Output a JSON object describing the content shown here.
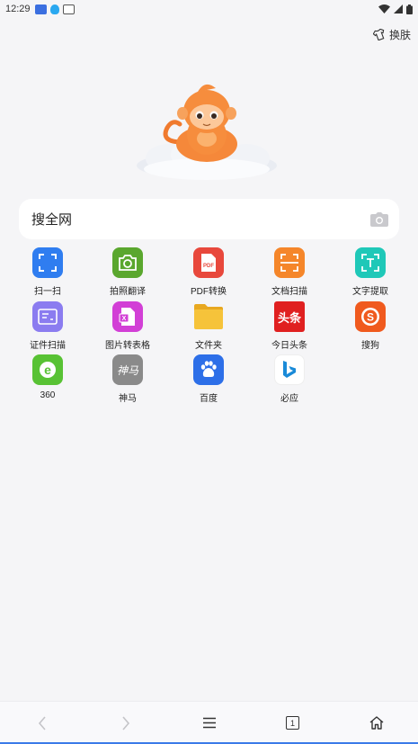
{
  "status_bar": {
    "time": "12:29",
    "notification_icons": [
      "app-badge-icon",
      "qq-penguin-icon",
      "sd-card-icon"
    ]
  },
  "header": {
    "skin_label": "换肤"
  },
  "search": {
    "placeholder": "搜全网",
    "camera_icon": "camera-icon"
  },
  "grid": {
    "items": [
      {
        "label": "扫一扫",
        "icon": "scan-icon",
        "color": "#2f7df0"
      },
      {
        "label": "拍照翻译",
        "icon": "photo-translate-icon",
        "color": "#5aa72e"
      },
      {
        "label": "PDF转换",
        "icon": "pdf-convert-icon",
        "color": "#e8483c"
      },
      {
        "label": "文档扫描",
        "icon": "doc-scan-icon",
        "color": "#f5862a"
      },
      {
        "label": "文字提取",
        "icon": "text-extract-icon",
        "color": "#1fc8b8"
      },
      {
        "label": "证件扫描",
        "icon": "id-scan-icon",
        "color": "#8b7cf0"
      },
      {
        "label": "图片转表格",
        "icon": "image-to-table-icon",
        "color": "#d23fd6"
      },
      {
        "label": "文件夹",
        "icon": "folder-icon",
        "color": "#f4c02e"
      },
      {
        "label": "今日头条",
        "icon": "toutiao-logo-icon",
        "color": "#e02020",
        "logo_text": "头条"
      },
      {
        "label": "搜狗",
        "icon": "sogou-logo-icon",
        "color": "#f05a1e"
      },
      {
        "label": "360",
        "icon": "360-browser-logo-icon",
        "color": "#58c234"
      },
      {
        "label": "神马",
        "icon": "shenma-logo-icon",
        "color": "#8a8a8a",
        "logo_text": "神马"
      },
      {
        "label": "百度",
        "icon": "baidu-paw-icon",
        "color": "#2d6fe8"
      },
      {
        "label": "必应",
        "icon": "bing-logo-icon",
        "color": "#ffffff"
      }
    ]
  },
  "bottom_nav": {
    "back_icon": "back-arrow-icon",
    "forward_icon": "forward-arrow-icon",
    "menu_icon": "menu-icon",
    "tabs_count": "1",
    "home_icon": "home-icon"
  }
}
